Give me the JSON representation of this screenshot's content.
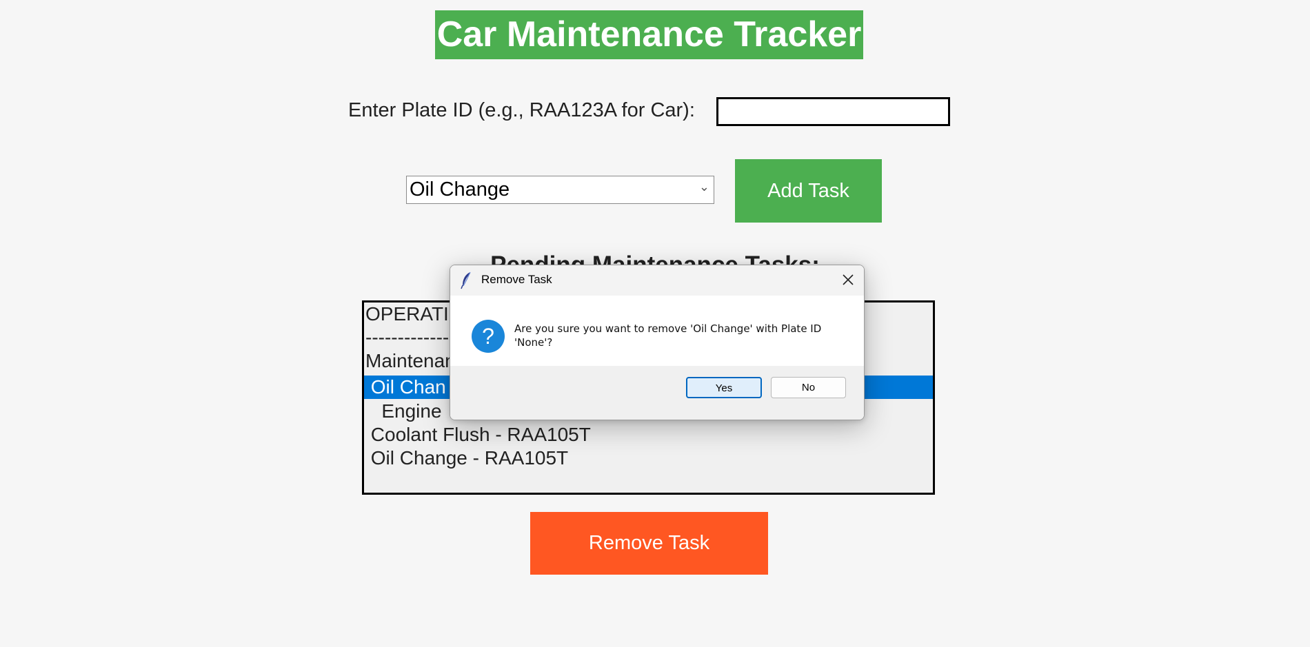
{
  "app": {
    "title": "Car Maintenance Tracker",
    "plate_label": "Enter Plate ID (e.g., RAA123A for Car):",
    "plate_value": "",
    "task_select_value": "Oil Change",
    "add_button": "Add Task",
    "pending_heading": "Pending Maintenance Tasks:",
    "remove_button": "Remove Task",
    "colors": {
      "title_bg": "#4caf50",
      "add_button_bg": "#4caf50",
      "remove_button_bg": "#ff5722",
      "selection_bg": "#0078d7"
    }
  },
  "task_list": {
    "rows": [
      {
        "text": "OPERATI",
        "selected": false
      },
      {
        "text": "------------------------",
        "selected": false
      },
      {
        "text": "Maintenan",
        "selected": false
      },
      {
        "text": " Oil Chan",
        "selected": true
      },
      {
        "text": "   Engine",
        "selected": false
      },
      {
        "text": " Coolant Flush - RAA105T",
        "selected": false
      },
      {
        "text": " Oil Change - RAA105T",
        "selected": false
      }
    ]
  },
  "dialog": {
    "title": "Remove Task",
    "message": "Are you sure you want to remove 'Oil Change' with Plate ID 'None'?",
    "yes_label": "Yes",
    "no_label": "No",
    "icons": {
      "title": "feather-icon",
      "close": "close-icon",
      "question": "question-icon"
    },
    "question_glyph": "?"
  }
}
